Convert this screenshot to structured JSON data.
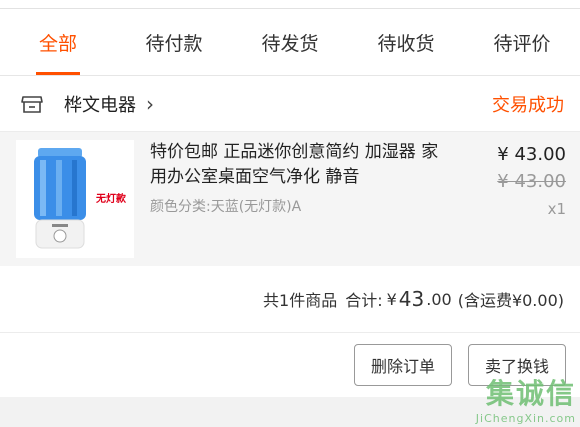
{
  "tabs": [
    {
      "label": "全部",
      "active": true
    },
    {
      "label": "待付款",
      "active": false
    },
    {
      "label": "待发货",
      "active": false
    },
    {
      "label": "待收货",
      "active": false
    },
    {
      "label": "待评价",
      "active": false
    }
  ],
  "order": {
    "shop_name": "桦文电器",
    "shop_icon": "store-icon",
    "status": "交易成功",
    "item": {
      "title": "特价包邮 正品迷你创意简约 加湿器 家用办公室桌面空气净化 静音",
      "variant": "颜色分类:天蓝(无灯款)A",
      "image_tag": "无灯款",
      "price": "¥ 43.00",
      "original_price": "¥ 43.00",
      "quantity": "x1"
    },
    "summary": {
      "count_text": "共1件商品",
      "total_label": "合计:",
      "currency": "¥",
      "amount_int": "43",
      "amount_dec": ".00",
      "shipping": "(含运费¥0.00)"
    },
    "buttons": {
      "delete": "删除订单",
      "resell": "卖了换钱"
    }
  },
  "watermark": {
    "main": "集诚信",
    "sub": "JiChengXin.com"
  },
  "colors": {
    "accent": "#ff5000",
    "humidifier_blue": "#2a7de1"
  }
}
